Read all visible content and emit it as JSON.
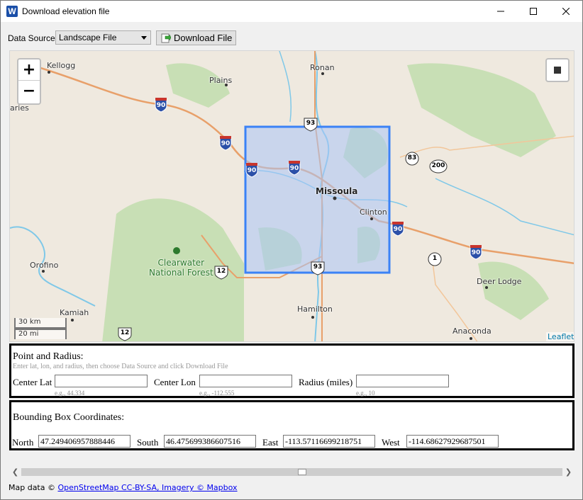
{
  "window": {
    "title": "Download elevation file",
    "icon": "W"
  },
  "toolbar": {
    "data_source_label": "Data Source",
    "data_source_value": "Landscape File",
    "download_label": "Download File"
  },
  "map": {
    "zoom_in": "+",
    "zoom_out": "−",
    "scale_km": "30 km",
    "scale_mi": "20 mi",
    "attribution": "Leaflet",
    "places": {
      "kellogg": "Kellogg",
      "plains": "Plains",
      "ronan": "Ronan",
      "aries": "aries",
      "missoula": "Missoula",
      "clinton": "Clinton",
      "orofino": "Orofino",
      "kamiah": "Kamiah",
      "hamilton": "Hamilton",
      "deer_lodge": "Deer Lodge",
      "anaconda": "Anaconda",
      "forest_line1": "Clearwater",
      "forest_line2": "National Forest"
    },
    "shields": {
      "i90": "90",
      "us93": "93",
      "us12": "12",
      "r83": "83",
      "r200": "200",
      "r1": "1"
    },
    "colors": {
      "land": "#efe9df",
      "forest": "#c8dfb5",
      "water": "#7fc8e8",
      "selection_fill": "#a9c4f5",
      "selection_stroke": "#3b82f6"
    }
  },
  "point_radius": {
    "title": "Point and Radius:",
    "hint": "Enter lat, lon, and radius, then choose Data Source and click Download File",
    "center_lat_label": "Center Lat",
    "center_lat_value": "",
    "center_lat_hint": "e.g., 44.334",
    "center_lon_label": "Center Lon",
    "center_lon_value": "",
    "center_lon_hint": "e.g., -112.555",
    "radius_label": "Radius (miles)",
    "radius_value": "",
    "radius_hint": "e.g., 10"
  },
  "bbox": {
    "title": "Bounding Box Coordinates:",
    "north_label": "North",
    "north_value": "47.249406957888446",
    "south_label": "South",
    "south_value": "46.475699386607516",
    "east_label": "East",
    "east_value": "-113.57116699218751",
    "west_label": "West",
    "west_value": "-114.68627929687501"
  },
  "footer": {
    "prefix": "Map data ©",
    "link": "OpenStreetMap CC-BY-SA, Imagery © Mapbox"
  }
}
